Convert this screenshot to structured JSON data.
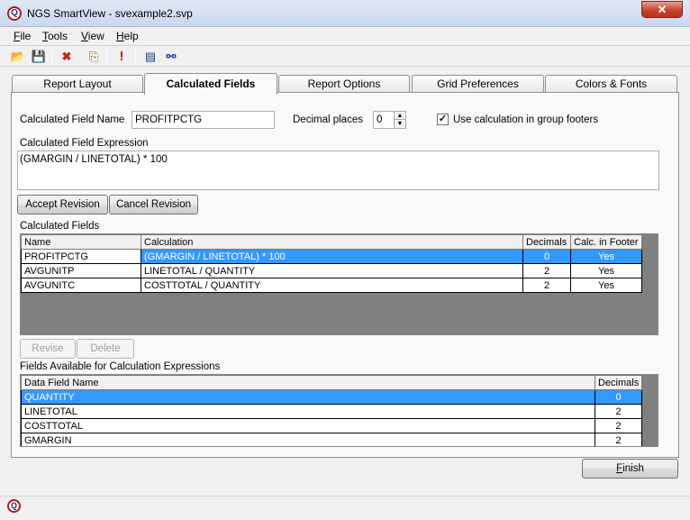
{
  "window": {
    "title": "NGS SmartView - svexample2.svp",
    "close_glyph": "✕",
    "app_icon_letter": "Q"
  },
  "menu": [
    {
      "label": "File",
      "ul": "F",
      "rest": "ile"
    },
    {
      "label": "Tools",
      "ul": "T",
      "rest": "ools"
    },
    {
      "label": "View",
      "ul": "V",
      "rest": "iew"
    },
    {
      "label": "Help",
      "ul": "H",
      "rest": "elp"
    }
  ],
  "toolbar": {
    "open_glyph": "📂",
    "save_glyph": "💾",
    "delete_glyph": "✖",
    "copy_glyph": "⎘",
    "run_glyph": "!",
    "preview_glyph": "▤",
    "binoculars_glyph": "⚯"
  },
  "tabs": [
    "Report Layout",
    "Calculated Fields",
    "Report Options",
    "Grid Preferences",
    "Colors & Fonts"
  ],
  "active_tab": "Calculated Fields",
  "form": {
    "calc_field_name_label": "Calculated Field Name",
    "calc_field_name_value": "PROFITPCTG",
    "decimal_places_label": "Decimal places",
    "decimal_places_value": "0",
    "group_footer_label": "Use calculation in group footers",
    "group_footer_checked": true,
    "expression_label": "Calculated Field Expression",
    "expression_value": "(GMARGIN / LINETOTAL) * 100",
    "accept_button": "Accept Revision",
    "cancel_button": "Cancel Revision"
  },
  "calculated_fields": {
    "label": "Calculated Fields",
    "columns": [
      "Name",
      "Calculation",
      "Decimals",
      "Calc. in Footer"
    ],
    "rows": [
      {
        "name": "PROFITPCTG",
        "calculation": "(GMARGIN / LINETOTAL) * 100",
        "decimals": "0",
        "footer": "Yes",
        "selected": true
      },
      {
        "name": "AVGUNITP",
        "calculation": "LINETOTAL / QUANTITY",
        "decimals": "2",
        "footer": "Yes",
        "selected": false
      },
      {
        "name": "AVGUNITC",
        "calculation": "COSTTOTAL / QUANTITY",
        "decimals": "2",
        "footer": "Yes",
        "selected": false
      }
    ]
  },
  "revise_button": "Revise",
  "delete_button": "Delete",
  "available_fields": {
    "label": "Fields Available for Calculation Expressions",
    "columns": [
      "Data Field Name",
      "Decimals"
    ],
    "rows": [
      {
        "name": "QUANTITY",
        "decimals": "0",
        "selected": true
      },
      {
        "name": "LINETOTAL",
        "decimals": "2",
        "selected": false
      },
      {
        "name": "COSTTOTAL",
        "decimals": "2",
        "selected": false
      },
      {
        "name": "GMARGIN",
        "decimals": "2",
        "selected": false
      }
    ]
  },
  "finish_button": {
    "ul": "F",
    "rest": "inish"
  },
  "colors": {
    "selection": "#3399ff",
    "grid_background": "#808080",
    "close_red": "#c7432c"
  }
}
